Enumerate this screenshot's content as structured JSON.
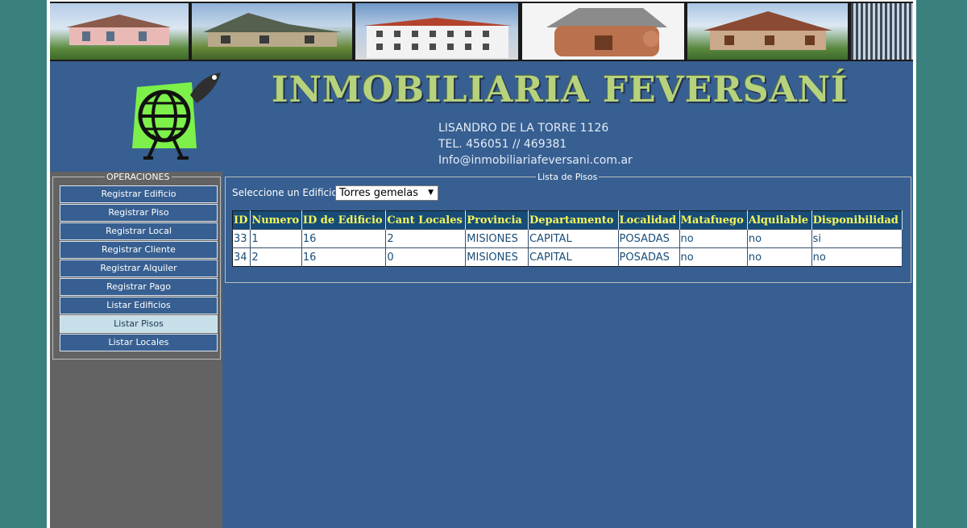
{
  "header": {
    "brand": "INMOBILIARIA FEVERSANÍ",
    "address": "LISANDRO DE LA TORRE 1126",
    "phone": "TEL. 456051 // 469381",
    "email": "Info@inmobiliariafeversani.com.ar",
    "logo": "globe-mascot-logo"
  },
  "banner": [
    "house-photo-1",
    "house-photo-2",
    "building-photo",
    "piggy-bank-house-photo",
    "house-photo-3",
    "glass-building-photo"
  ],
  "sidebar": {
    "legend": "OPERACIONES",
    "items": [
      {
        "label": "Registrar Edificio",
        "active": false
      },
      {
        "label": "Registrar Piso",
        "active": false
      },
      {
        "label": "Registrar Local",
        "active": false
      },
      {
        "label": "Registrar Cliente",
        "active": false
      },
      {
        "label": "Registrar Alquiler",
        "active": false
      },
      {
        "label": "Registrar Pago",
        "active": false
      },
      {
        "label": "Listar Edificios",
        "active": false
      },
      {
        "label": "Listar Pisos",
        "active": true
      },
      {
        "label": "Listar Locales",
        "active": false
      }
    ]
  },
  "main": {
    "legend": "Lista de Pisos",
    "select_label": "Seleccione un Edificio:",
    "select_value": "Torres gemelas",
    "table": {
      "headers": [
        "ID",
        "Numero",
        "ID de Edificio",
        "Cant Locales",
        "Provincia",
        "Departamento",
        "Localidad",
        "Matafuego",
        "Alquilable",
        "Disponibilidad"
      ],
      "rows": [
        [
          "33",
          "1",
          "16",
          "2",
          "MISIONES",
          "CAPITAL",
          "POSADAS",
          "no",
          "no",
          "si"
        ],
        [
          "34",
          "2",
          "16",
          "0",
          "MISIONES",
          "CAPITAL",
          "POSADAS",
          "no",
          "no",
          "no"
        ]
      ]
    }
  },
  "colors": {
    "page_bg": "#3a817e",
    "content_bg": "#375f91",
    "sidebar_bg": "#636363",
    "header_row_bg": "#184c78",
    "header_text": "#f5f55a",
    "active_item_bg": "#c7dfe8",
    "brand_text": "#b7d27c"
  }
}
